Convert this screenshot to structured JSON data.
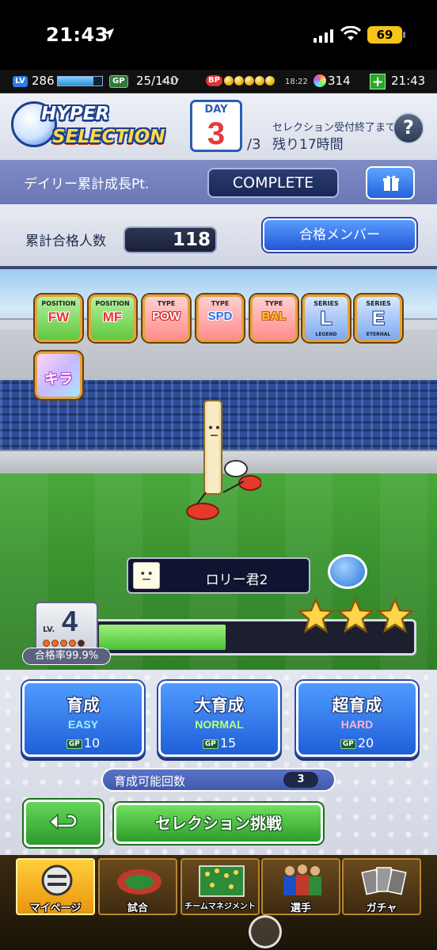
{
  "ios": {
    "time": "21:43",
    "battery": "69"
  },
  "header": {
    "lv_badge": "LV",
    "lv": "286",
    "gp_badge": "GP",
    "gp": "25/140",
    "gp_timer": "4:37",
    "bp_badge": "BP",
    "bp_timer": "18:22",
    "gems": "314",
    "add_label": "+",
    "clock": "21:43"
  },
  "selection": {
    "logo_line1": "HYPER",
    "logo_line2": "SELECTION",
    "day_label": "DAY",
    "day_number": "3",
    "day_total": "/3",
    "deadline_caption": "セレクション受付終了まで",
    "deadline_value": "残り17時間",
    "help_label": "?"
  },
  "daily": {
    "label": "デイリー累計成長Pt.",
    "status": "COMPLETE"
  },
  "passed": {
    "label": "累計合格人数",
    "value": "118",
    "members_button": "合格メンバー"
  },
  "chips": [
    {
      "top": "POSITION",
      "mid": "FW"
    },
    {
      "top": "POSITION",
      "mid": "MF"
    },
    {
      "top": "TYPE",
      "mid": "POW"
    },
    {
      "top": "TYPE",
      "mid": "SPD"
    },
    {
      "top": "TYPE",
      "mid": "BAL"
    },
    {
      "top": "SERIES",
      "mid": "L",
      "sub": "LEGEND"
    },
    {
      "top": "SERIES",
      "mid": "E",
      "sub": "ETERNAL"
    },
    {
      "top": "",
      "mid": "キラ"
    }
  ],
  "player": {
    "name": "ロリー君2",
    "level_label": "LV.",
    "level": "4",
    "level_dots_filled": 4,
    "level_dots_total": 5,
    "progress": 0.4,
    "stars": 3,
    "pass_rate": "合格率99.9%"
  },
  "training": [
    {
      "title": "育成",
      "level": "EASY",
      "level_color": "#9ff0ff",
      "cost": "10"
    },
    {
      "title": "大育成",
      "level": "NORMAL",
      "level_color": "#b8ff7a",
      "cost": "15"
    },
    {
      "title": "超育成",
      "level": "HARD",
      "level_color": "#ffb3d6",
      "cost": "20"
    }
  ],
  "gp_mini": "GP",
  "count": {
    "label": "育成可能回数",
    "value": "3"
  },
  "challenge_button": "セレクション挑戦",
  "nav": [
    {
      "label": "マイページ",
      "icon": "mypage-icon"
    },
    {
      "label": "試合",
      "icon": "stadium-icon"
    },
    {
      "label": "チームマネジメント",
      "icon": "formation-icon"
    },
    {
      "label": "選手",
      "icon": "players-icon"
    },
    {
      "label": "ガチャ",
      "icon": "gacha-cards-icon"
    }
  ]
}
